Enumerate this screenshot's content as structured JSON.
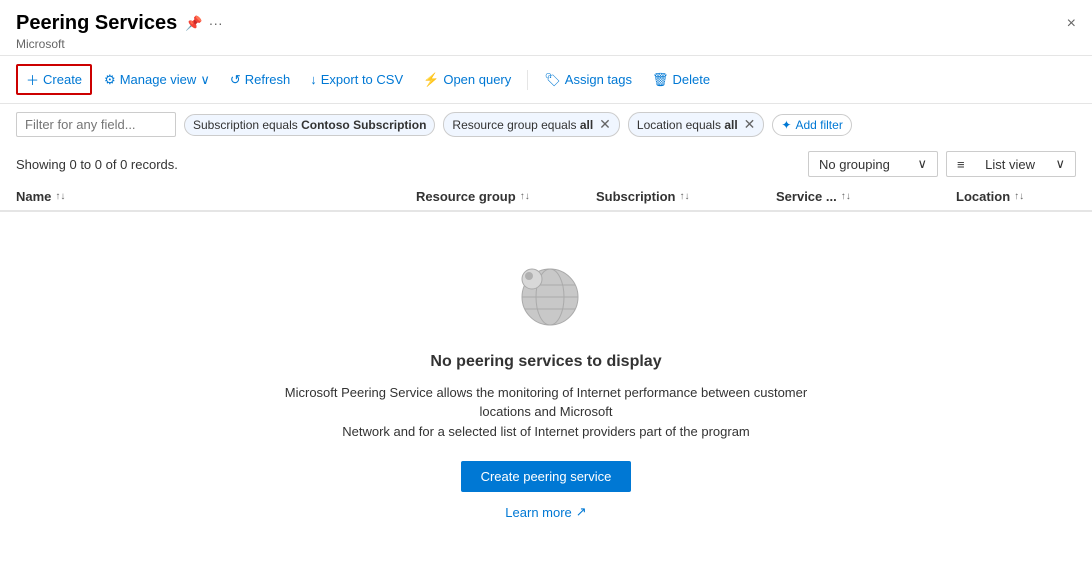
{
  "header": {
    "title": "Peering Services",
    "subtitle": "Microsoft",
    "close_label": "×"
  },
  "toolbar": {
    "create_label": "Create",
    "manage_view_label": "Manage view",
    "refresh_label": "Refresh",
    "export_label": "Export to CSV",
    "open_query_label": "Open query",
    "assign_tags_label": "Assign tags",
    "delete_label": "Delete"
  },
  "filters": {
    "placeholder": "Filter for any field...",
    "tags": [
      {
        "key": "Subscription equals",
        "value": "Contoso Subscription",
        "closeable": false
      },
      {
        "key": "Resource group equals",
        "value": "all",
        "closeable": true
      },
      {
        "key": "Location equals",
        "value": "all",
        "closeable": true
      }
    ],
    "add_filter_label": "Add filter"
  },
  "stats": {
    "text": "Showing 0 to 0 of 0 records."
  },
  "view_controls": {
    "grouping_label": "No grouping",
    "list_view_label": "List view"
  },
  "table": {
    "columns": [
      {
        "label": "Name",
        "sort": "↑↓"
      },
      {
        "label": "Resource group",
        "sort": "↑↓"
      },
      {
        "label": "Subscription",
        "sort": "↑↓"
      },
      {
        "label": "Service ...",
        "sort": "↑↓"
      },
      {
        "label": "Location",
        "sort": "↑↓"
      }
    ]
  },
  "empty_state": {
    "title": "No peering services to display",
    "description_part1": "Microsoft Peering Service allows the monitoring of Internet performance between customer locations and Microsoft",
    "description_part2": "Network and for a selected list of Internet providers part of the program",
    "create_button_label": "Create peering service",
    "learn_more_label": "Learn more"
  }
}
